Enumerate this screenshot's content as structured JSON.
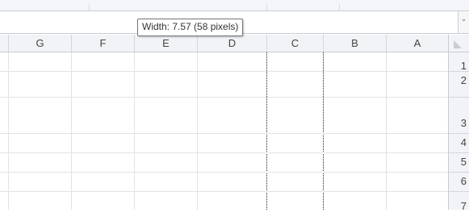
{
  "tooltip": {
    "text": "Width: 7.57 (58 pixels)"
  },
  "column_headers": [
    "G",
    "F",
    "E",
    "D",
    "C",
    "B",
    "A"
  ],
  "row_headers": [
    "1",
    "2",
    "3",
    "4",
    "5",
    "6",
    "7"
  ],
  "icons": {
    "formula_scroll": "chevron-down-icon",
    "select_all": "select-all-triangle-icon"
  }
}
